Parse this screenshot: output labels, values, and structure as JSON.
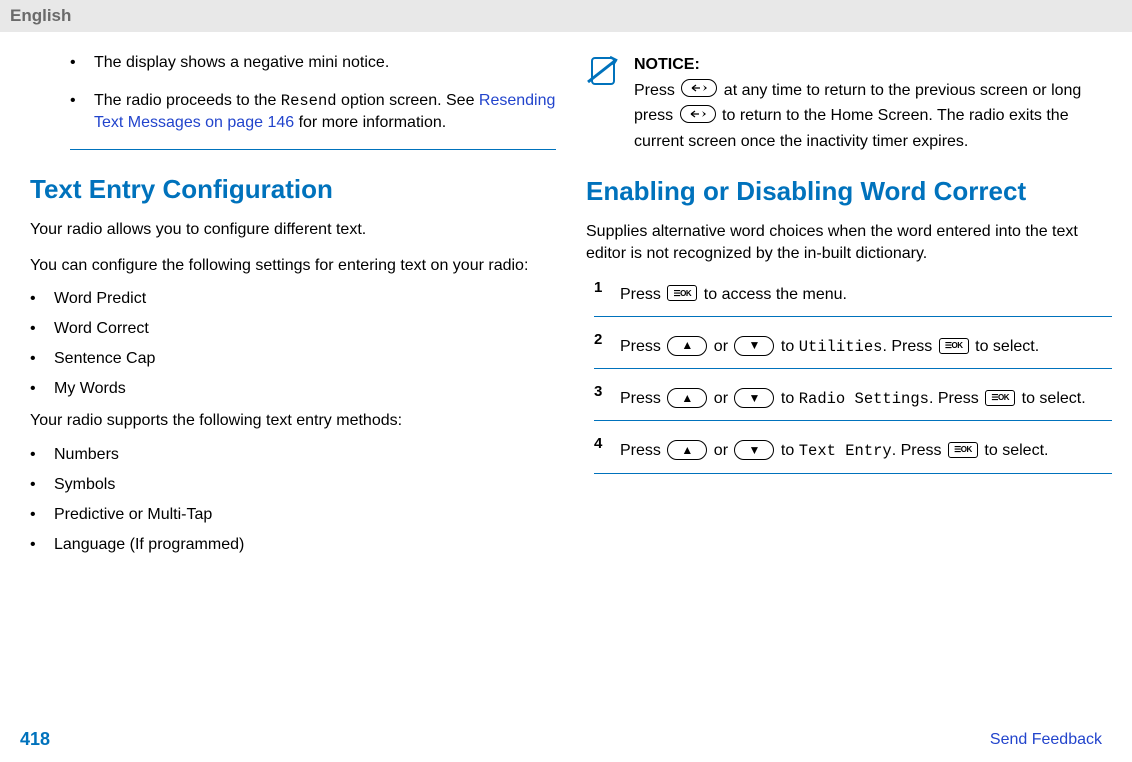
{
  "header": {
    "language": "English"
  },
  "left": {
    "bullets": [
      {
        "text": "The display shows a negative mini notice."
      },
      {
        "prefix": "The radio proceeds to the ",
        "code": "Resend",
        "middle": " option screen. See ",
        "link": "Resending Text Messages on page 146",
        "suffix": " for more information."
      }
    ],
    "heading": "Text Entry Configuration",
    "intro1": "Your radio allows you to configure different text.",
    "intro2": "You can configure the following settings for entering text on your radio:",
    "settings": [
      "Word Predict",
      "Word Correct",
      "Sentence Cap",
      "My Words"
    ],
    "methods_intro": "Your radio supports the following text entry methods:",
    "methods": [
      "Numbers",
      "Symbols",
      "Predictive or Multi-Tap",
      "Language (If programmed)"
    ]
  },
  "right": {
    "notice": {
      "label": "NOTICE:",
      "t1": "Press ",
      "t2": " at any time to return to the previous screen or long press ",
      "t3": " to return to the Home Screen. The radio exits the current screen once the inactivity timer expires."
    },
    "heading": "Enabling or Disabling Word Correct",
    "intro": "Supplies alternative word choices when the word entered into the text editor is not recognized by the in-built dictionary.",
    "steps": {
      "s1": {
        "a": "Press ",
        "b": " to access the menu."
      },
      "s2": {
        "a": "Press ",
        "or": " or ",
        "to": " to ",
        "code": "Utilities",
        "c": ". Press ",
        "d": " to select."
      },
      "s3": {
        "a": "Press ",
        "or": " or ",
        "to": " to ",
        "code": "Radio Settings",
        "c": ". Press ",
        "d": " to select."
      },
      "s4": {
        "a": "Press ",
        "or": " or ",
        "to": " to ",
        "code": "Text Entry",
        "c": ". Press ",
        "d": " to select."
      }
    }
  },
  "footer": {
    "page": "418",
    "feedback": "Send Feedback"
  },
  "icons": {
    "ok": "⦻ OK",
    "up": "▲",
    "down": "▼"
  }
}
